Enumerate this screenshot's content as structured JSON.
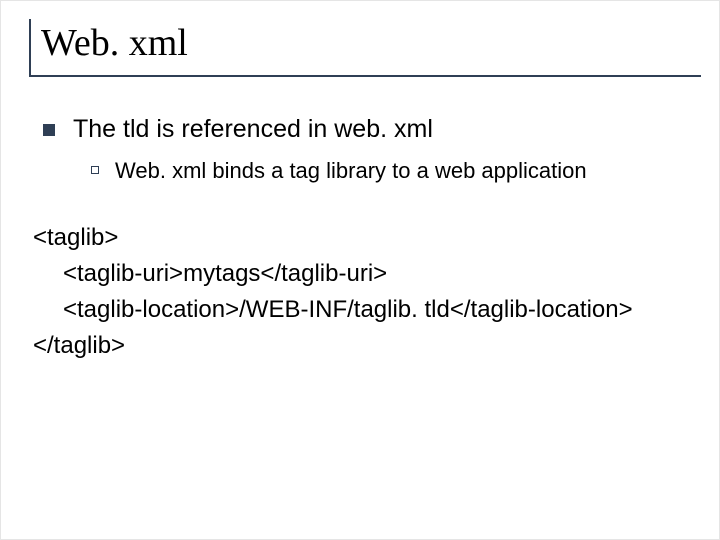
{
  "title": "Web. xml",
  "bullet1": "The tld is referenced in web. xml",
  "bullet2": "Web. xml binds a tag library to a web application",
  "code": {
    "l1": "<taglib>",
    "l2": "<taglib-uri>mytags</taglib-uri>",
    "l3": "<taglib-location>/WEB-INF/taglib. tld</taglib-location>",
    "l4": "</taglib>"
  }
}
